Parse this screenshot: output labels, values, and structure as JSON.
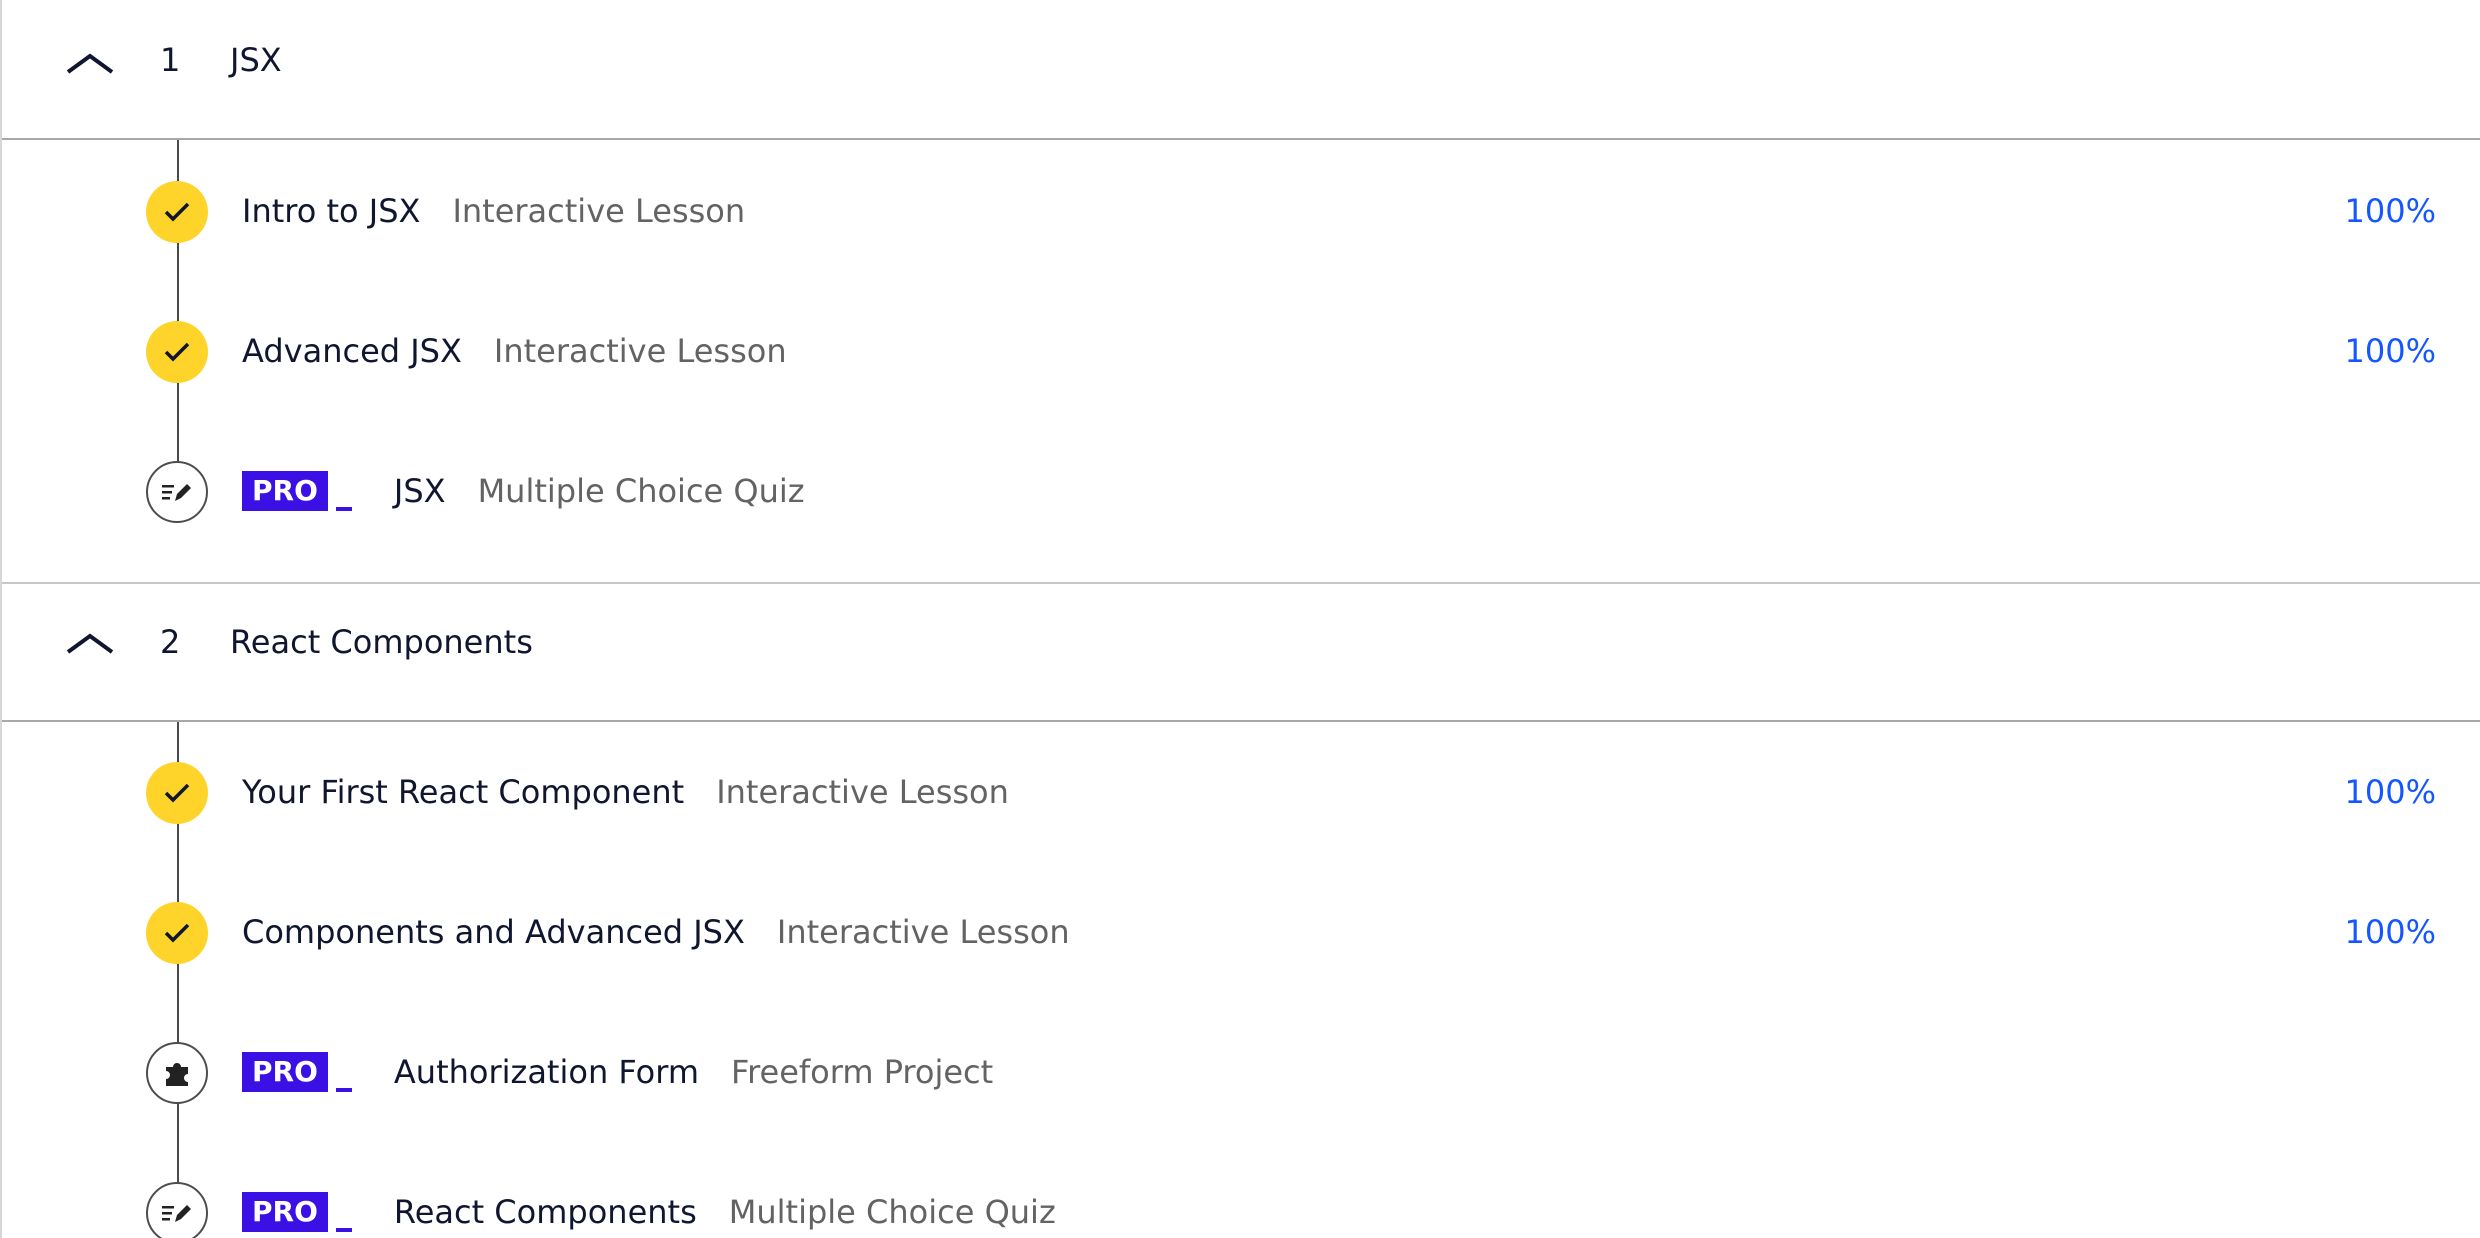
{
  "modules": [
    {
      "number": "1",
      "title": "JSX",
      "items": [
        {
          "title": "Intro to JSX",
          "type": "Interactive Lesson",
          "progress": "100%",
          "status": "complete",
          "icon": "check-icon"
        },
        {
          "title": "Advanced JSX",
          "type": "Interactive Lesson",
          "progress": "100%",
          "status": "complete",
          "icon": "check-icon"
        },
        {
          "title": "JSX",
          "type": "Multiple Choice Quiz",
          "badge": "PRO",
          "status": "locked",
          "icon": "quiz-pencil-icon"
        }
      ]
    },
    {
      "number": "2",
      "title": "React Components",
      "items": [
        {
          "title": "Your First React Component",
          "type": "Interactive Lesson",
          "progress": "100%",
          "status": "complete",
          "icon": "check-icon"
        },
        {
          "title": "Components and Advanced JSX",
          "type": "Interactive Lesson",
          "progress": "100%",
          "status": "complete",
          "icon": "check-icon"
        },
        {
          "title": "Authorization Form",
          "type": "Freeform Project",
          "badge": "PRO",
          "status": "locked",
          "icon": "puzzle-icon"
        },
        {
          "title": "React Components",
          "type": "Multiple Choice Quiz",
          "badge": "PRO",
          "status": "locked",
          "icon": "quiz-pencil-icon"
        }
      ]
    }
  ],
  "colors": {
    "complete": "#ffd42a",
    "pro": "#3a10e5",
    "progress": "#1557ff"
  }
}
